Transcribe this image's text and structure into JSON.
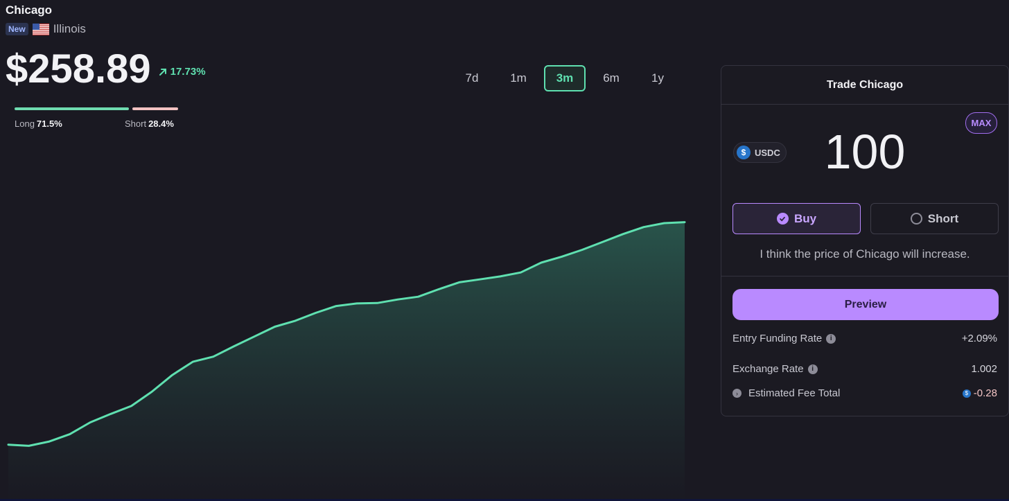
{
  "market": {
    "name": "Chicago",
    "badge": "New",
    "flag_icon": "us-flag-icon",
    "state": "Illinois",
    "price": "$258.89",
    "change": "17.73%",
    "change_color": "#5fe0b0"
  },
  "sentiment": {
    "long_label": "Long",
    "long_value": "71.5%",
    "long_fraction": 0.715,
    "short_label": "Short",
    "short_value": "28.4%",
    "short_fraction": 0.284,
    "long_color": "#6fdcb0",
    "short_color": "#f3c2c2"
  },
  "ranges": {
    "tabs": [
      "7d",
      "1m",
      "3m",
      "6m",
      "1y"
    ],
    "selected": "3m"
  },
  "chart_data": {
    "type": "area",
    "series": [
      {
        "values": [
          8.2,
          7.6,
          9.8,
          13.5,
          19.5,
          23.8,
          27.8,
          35.0,
          43.5,
          50.2,
          52.8,
          58.0,
          63.0,
          68.0,
          71.0,
          75.0,
          78.5,
          79.8,
          80.0,
          81.8,
          83.2,
          87.0,
          90.5,
          92.0,
          93.5,
          95.5,
          100.5,
          103.5,
          107.0,
          111.0,
          115.0,
          118.5,
          120.5,
          121.0
        ]
      }
    ],
    "grid": false,
    "line_color": "#5fe0b0"
  },
  "trade": {
    "title": "Trade Chicago",
    "token": "USDC",
    "token_icon": "usdc-icon",
    "amount": "100",
    "max_label": "MAX",
    "buy_label": "Buy",
    "short_label": "Short",
    "hint": "I think the price of Chicago will increase.",
    "preview_label": "Preview",
    "accent": "#b98aff",
    "rows": [
      {
        "label": "Entry Funding Rate",
        "value": "+2.09%"
      },
      {
        "label": "Exchange Rate",
        "value": "1.002"
      },
      {
        "label": "Estimated Fee Total",
        "value": "-0.28"
      }
    ]
  }
}
